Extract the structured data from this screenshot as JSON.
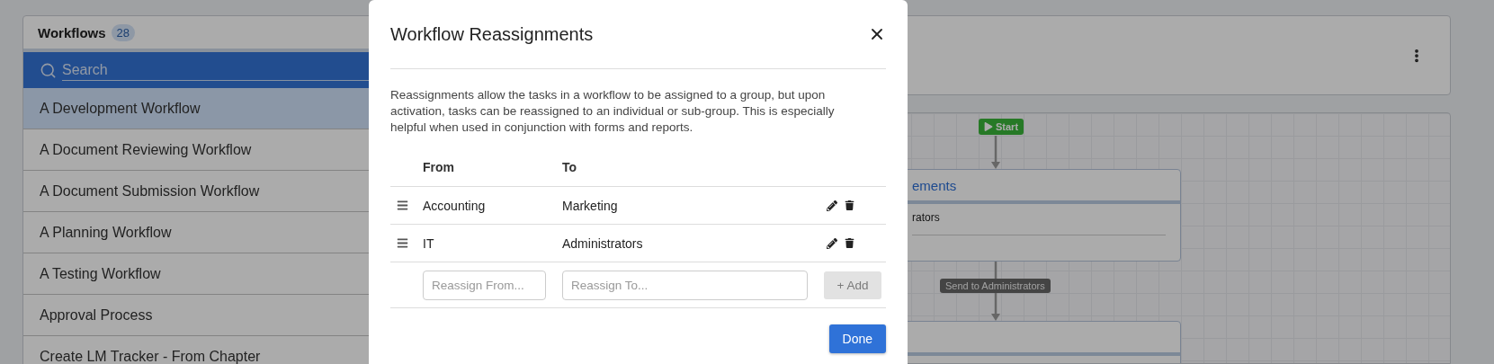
{
  "sidebar": {
    "title": "Workflows",
    "count": "28",
    "search": {
      "placeholder": "Search"
    },
    "items": [
      {
        "label": "A Development Workflow",
        "selected": true
      },
      {
        "label": "A Document Reviewing Workflow",
        "selected": false
      },
      {
        "label": "A Document Submission Workflow",
        "selected": false
      },
      {
        "label": "A Planning Workflow",
        "selected": false
      },
      {
        "label": "A Testing Workflow",
        "selected": false
      },
      {
        "label": "Approval Process",
        "selected": false
      },
      {
        "label": "Create LM Tracker - From Chapter",
        "selected": false
      }
    ]
  },
  "diagram": {
    "start": "Start",
    "connector_label": "Send to Administrators",
    "nodes": [
      {
        "kind": "task",
        "title": "ements",
        "body": "rators"
      },
      {
        "kind": "task"
      }
    ]
  },
  "dialog": {
    "title": "Workflow Reassignments",
    "description": "Reassignments allow the tasks in a workflow to be assigned to a group, but upon activation, tasks can be reassigned to an individual or sub-group. This is especially helpful when used in conjunction with forms and reports.",
    "columns": [
      "From",
      "To"
    ],
    "rows": [
      {
        "from": "Accounting",
        "to": "Marketing"
      },
      {
        "from": "IT",
        "to": "Administrators"
      }
    ],
    "new_row": {
      "from_placeholder": "Reassign From...",
      "to_placeholder": "Reassign To...",
      "add_button": {
        "label": "+ Add",
        "disabled": true
      }
    },
    "done": "Done"
  }
}
